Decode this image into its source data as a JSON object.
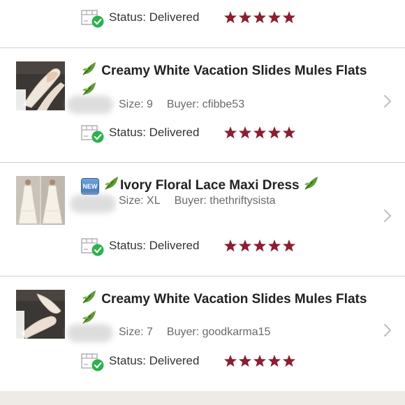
{
  "rows": [
    {
      "status_label": "Status:",
      "status_value": "Delivered",
      "rating": 5
    },
    {
      "title": "Creamy White Vacation Slides Mules Flats",
      "size_label": "Size: 9",
      "buyer_label": "Buyer: cfibbe53",
      "status_label": "Status:",
      "status_value": "Delivered",
      "rating": 5
    },
    {
      "title": "Ivory Floral Lace Maxi Dress",
      "badge": "NEW",
      "size_label": "Size: XL",
      "buyer_label": "Buyer: thethriftysista",
      "status_label": "Status:",
      "status_value": "Delivered",
      "rating": 5
    },
    {
      "title": "Creamy White Vacation Slides Mules Flats",
      "size_label": "Size: 7",
      "buyer_label": "Buyer: goodkarma15",
      "status_label": "Status:",
      "status_value": "Delivered",
      "rating": 5
    }
  ],
  "colors": {
    "star": "#8b1e2f",
    "delivered_check": "#2bb24c",
    "separator": "#cfcfcf",
    "leaf": "#4f8f2a"
  },
  "icons": {
    "leaf": "leaf-icon",
    "status": "delivered-box-icon",
    "chevron": "chevron-right-icon",
    "star": "star-icon",
    "badge": "new-badge-icon"
  }
}
